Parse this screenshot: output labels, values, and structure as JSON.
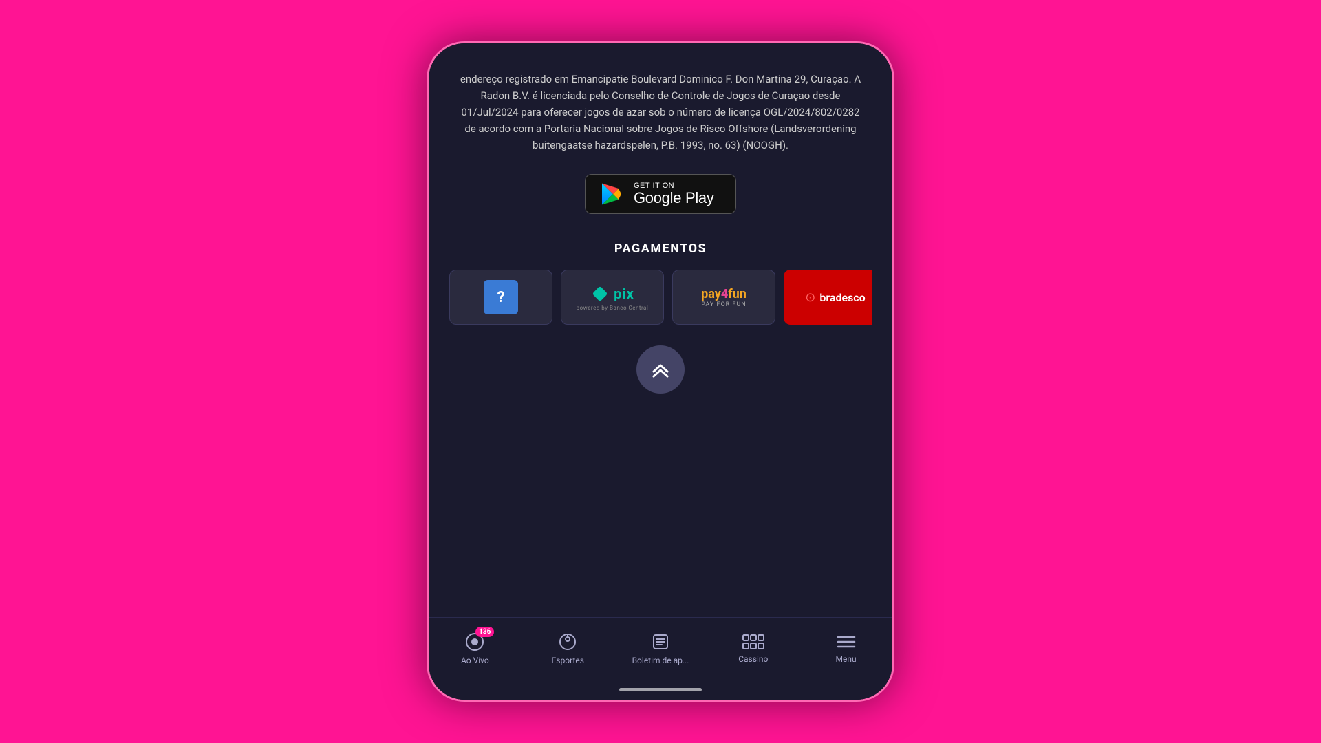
{
  "legal": {
    "text": "endereço registrado em Emancipatie Boulevard Dominico F. Don Martina 29, Curaçao. A Radon B.V. é licenciada pelo Conselho de Controle de Jogos de Curaçao desde 01/Jul/2024 para oferecer jogos de azar sob o número de licença OGL/2024/802/0282 de acordo com a Portaria Nacional sobre Jogos de Risco Offshore (Landsverordening buitengaatse hazardspelen, P.B. 1993, no. 63) (NOOGH)."
  },
  "google_play": {
    "get_it_on": "GET IT ON",
    "label": "Google Play"
  },
  "payments": {
    "title": "PAGAMENTOS",
    "cards": [
      {
        "id": "unknown",
        "label": "?"
      },
      {
        "id": "pix",
        "label": "pix",
        "subtitle": "powered by Banco Central"
      },
      {
        "id": "pay4fun",
        "label": "pay4fun",
        "sublabel": "PAY FOR FUN"
      },
      {
        "id": "bradesco",
        "label": "bradesco"
      }
    ]
  },
  "scroll_top": {
    "label": "scroll to top"
  },
  "nav": {
    "items": [
      {
        "id": "ao-vivo",
        "label": "Ao Vivo",
        "badge": "136"
      },
      {
        "id": "esportes",
        "label": "Esportes",
        "badge": ""
      },
      {
        "id": "boletim",
        "label": "Boletim de ap...",
        "badge": ""
      },
      {
        "id": "cassino",
        "label": "Cassino",
        "badge": ""
      },
      {
        "id": "menu",
        "label": "Menu",
        "badge": ""
      }
    ]
  }
}
